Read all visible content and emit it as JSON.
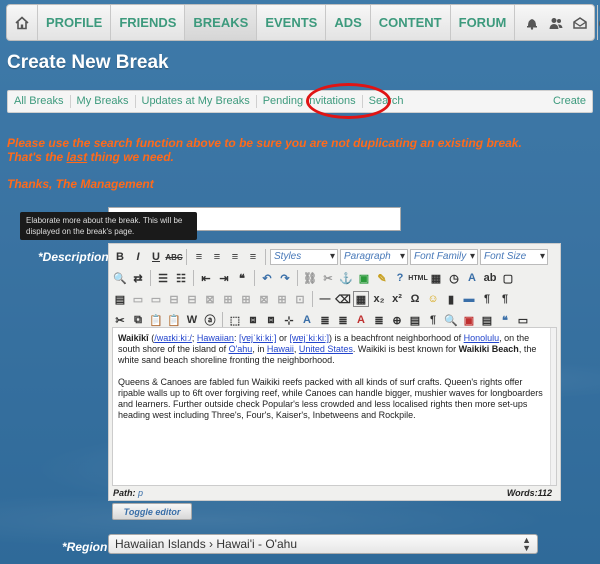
{
  "nav": {
    "items": [
      {
        "label": "PROFILE"
      },
      {
        "label": "FRIENDS"
      },
      {
        "label": "BREAKS"
      },
      {
        "label": "EVENTS"
      },
      {
        "label": "ADS"
      },
      {
        "label": "CONTENT"
      },
      {
        "label": "FORUM"
      }
    ],
    "active": "BREAKS",
    "icons": [
      "home-icon",
      "bell-icon",
      "people-icon",
      "mail-icon",
      "power-icon"
    ]
  },
  "page": {
    "title": "Create New Break"
  },
  "subnav": {
    "items": [
      "All Breaks",
      "My Breaks",
      "Updates at My Breaks",
      "Pending Invitations",
      "Search"
    ],
    "create": "Create"
  },
  "notice": {
    "line1": "Please use the search function above to be sure you are not duplicating an existing break.",
    "line2_before": "That's the ",
    "line2_emph": "last",
    "line2_after": " thing we need.",
    "signoff": "Thanks, The Management"
  },
  "form": {
    "tooltip": "Elaborate more about the break. This will be displayed on the break's page.",
    "description_label": "*Description",
    "region_label": "*Region",
    "region_value": "Hawaiian Islands › Hawai'i - O'ahu",
    "toggle_editor": "Toggle editor",
    "selects": {
      "styles": "Styles",
      "paragraph": "Paragraph",
      "font_family": "Font Family",
      "font_size": "Font Size"
    },
    "path_label": "Path:",
    "path_value": "p",
    "words": "Words:112"
  },
  "editor": {
    "p1_bold": "Waikīkī",
    "p1_link1": "/waɪkiːkiː/",
    "p1_sep1": "; ",
    "p1_link2": "Hawaiian",
    "p1_sep2": ": ",
    "p1_link3": "[vɐjˈkiːkiː]",
    "p1_or": " or ",
    "p1_link4": "[wɐjˈkiːkiː]",
    "p1_text1": ") is a beachfront neighborhood of ",
    "p1_link5": "Honolulu",
    "p1_text2": ", on the south shore of the island of ",
    "p1_link6": "O'ahu",
    "p1_text3": ", in ",
    "p1_link7": "Hawaii",
    "p1_text4": ", ",
    "p1_link8": "United States",
    "p1_text5": ". Waikiki is best known for ",
    "p1_bold2": "Waikiki Beach",
    "p1_text6": ", the white sand beach shoreline fronting the neighborhood.",
    "p2": "Queens & Canoes are fabled fun Waikiki reefs packed with all kinds of surf crafts. Queen's rights offer ripable walls up to 6ft over forgiving reef, while Canoes can handle bigger, mushier waves for longboarders and learners. Further outside check Popular's less crowded and less localised rights then more set-ups heading west including Three's, Four's, Kaiser's, Inbetweens and Rockpile."
  },
  "colors": {
    "accent": "#3d9a7d",
    "warning": "#ff6a1a",
    "highlight": "#e01414"
  }
}
